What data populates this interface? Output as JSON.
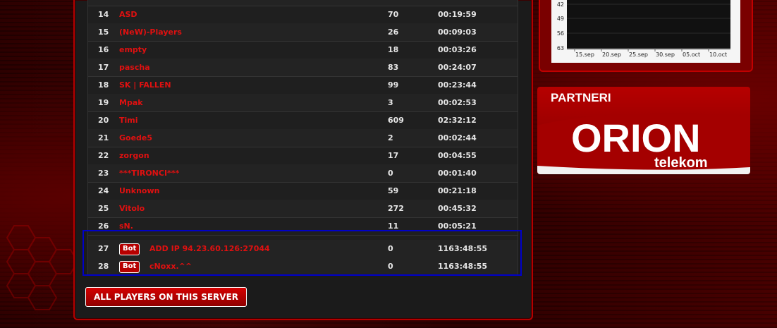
{
  "players": [
    {
      "rank": "14",
      "name": "ASD",
      "score": "70",
      "time": "00:19:59"
    },
    {
      "rank": "15",
      "name": "(NeW)-Players",
      "score": "26",
      "time": "00:09:03"
    },
    {
      "rank": "16",
      "name": "empty",
      "score": "18",
      "time": "00:03:26"
    },
    {
      "rank": "17",
      "name": "pascha",
      "score": "83",
      "time": "00:24:07"
    },
    {
      "rank": "18",
      "name": "SK | FALLEN",
      "score": "99",
      "time": "00:23:44"
    },
    {
      "rank": "19",
      "name": "Mpak",
      "score": "3",
      "time": "00:02:53"
    },
    {
      "rank": "20",
      "name": "Timi",
      "score": "609",
      "time": "02:32:12"
    },
    {
      "rank": "21",
      "name": "Goede5",
      "score": "2",
      "time": "00:02:44"
    },
    {
      "rank": "22",
      "name": "zorgon",
      "score": "17",
      "time": "00:04:55"
    },
    {
      "rank": "23",
      "name": "***TIRONCI***",
      "score": "0",
      "time": "00:01:40"
    },
    {
      "rank": "24",
      "name": "Unknown",
      "score": "59",
      "time": "00:21:18"
    },
    {
      "rank": "25",
      "name": "Vitolo",
      "score": "272",
      "time": "00:45:32"
    },
    {
      "rank": "26",
      "name": "sN.",
      "score": "11",
      "time": "00:05:21"
    }
  ],
  "bots": [
    {
      "rank": "27",
      "badge": "Bot",
      "name": "ADD IP 94.23.60.126:27044",
      "score": "0",
      "time": "1163:48:55"
    },
    {
      "rank": "28",
      "badge": "Bot",
      "name": "cNoxx.^^",
      "score": "0",
      "time": "1163:48:55"
    }
  ],
  "all_players_button": "ALL PLAYERS ON THIS SERVER",
  "chart": {
    "y_ticks": [
      "42",
      "49",
      "56",
      "63"
    ],
    "x_ticks": [
      "15.sep",
      "20.sep",
      "25.sep",
      "30.sep",
      "05.oct",
      "10.oct"
    ]
  },
  "partner": {
    "title": "PARTNERI",
    "logo_word": "ORION",
    "logo_sub": "telekom"
  },
  "colors": {
    "accent_red": "#e01010",
    "highlight_blue": "#0000c8",
    "badge_red": "#b70000"
  }
}
